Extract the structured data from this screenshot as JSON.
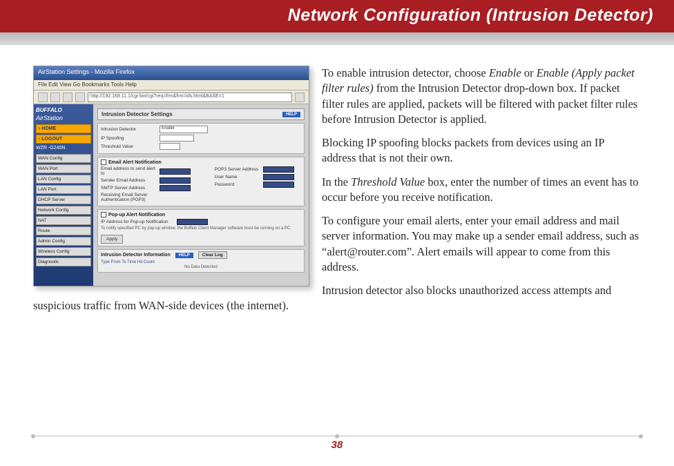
{
  "header": {
    "title": "Network Configuration (Intrusion Detector)"
  },
  "screenshot": {
    "window_title": "AirStation Settings - Mozilla Firefox",
    "menu": "File  Edit  View  Go  Bookmarks  Tools  Help",
    "address": "http://192.168.11.1/cgi-bin/cgi?req=frm&frm=ids.html&BASE=1",
    "brand1": "BUFFALO",
    "brand2": "AirStation",
    "side_home": "› HOME",
    "side_logout": "› LOGOUT",
    "side_ver": "WZR -G240N",
    "side_items": [
      "WAN Config",
      "WAN Port",
      "LAN Config",
      "LAN Port",
      "DHCP Server",
      "Network Config",
      "NAT",
      "Route",
      "Admin Config",
      "Wireless Config",
      "Diagnostic"
    ],
    "panel_title": "Intrusion Detector Settings",
    "help": "HELP",
    "fields": {
      "intrusion_detector": "Intrusion Detector",
      "enable_opt": "Enable",
      "ip_spoofing": "IP Spoofing",
      "threshold": "Threshold Value"
    },
    "email_sec": "Email Alert Notification",
    "email_lbls": [
      "Email address to send alert to",
      "Sender Email Address",
      "SMTP Server Address"
    ],
    "pop_lbl": "Receiving Email Server Authentication (POP3)",
    "pop_cols": [
      "POP3 Server Address",
      "User Name",
      "Password"
    ],
    "popup_sec": "Pop-up Alert Notification",
    "popup_lbl": "IP Address for Pop-up Notification",
    "popup_note": "To notify specified PC by pop-up window, the Buffalo Client Manager software must be running on a PC.",
    "info_sec": "Intrusion Detector Information",
    "info_cols": "Type      From      To      Time      Hit Count",
    "info_none": "No Data Detected",
    "apply": "Apply",
    "clear": "Clear Log"
  },
  "body": {
    "p1a": "To enable intrusion detector, choose ",
    "p1b": "Enable",
    "p1c": " or ",
    "p1d": "Enable (Apply packet filter rules)",
    "p1e": " from the Intrusion Detector drop-down box.  If packet filter rules are applied, packets will be filtered with packet filter rules before Intrusion Detector is applied.",
    "p2": "Blocking IP spoofing blocks packets from devices using an IP address that is not their own.",
    "p3a": "In the ",
    "p3b": "Threshold Value",
    "p3c": " box, enter the number of times an event has to occur before you receive notification.",
    "p4": "To configure your email alerts, enter your email address and mail server information. You may make up a sender email address, such as “alert@router.com”.  Alert emails will appear to come from this address.",
    "p5": "Intrusion detector also blocks unauthorized access attempts and suspicious traffic from WAN-side devices (the internet)."
  },
  "page_number": "38"
}
